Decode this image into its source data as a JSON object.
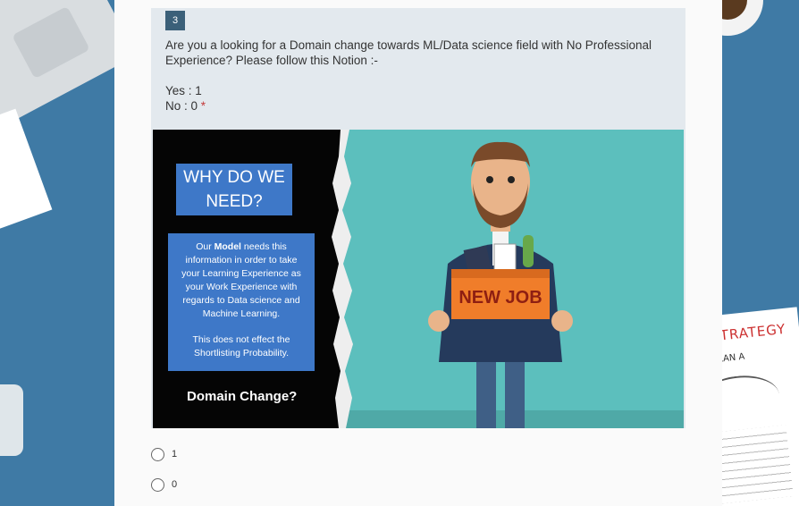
{
  "question": {
    "number": "3",
    "text": "Are you a looking for a Domain change towards ML/Data science field with No Professional Experience? Please follow this Notion :-",
    "yes_line": "Yes : 1",
    "no_line": "No : 0",
    "required_mark": "*"
  },
  "illustration": {
    "heading": "WHY DO WE NEED?",
    "info_pre": "Our ",
    "info_bold": "Model",
    "info_post": " needs this information in order to take your Learning Experience as your Work Experience with regards to Data science and Machine Learning.",
    "info_note": "This does not effect the Shortlisting Probability.",
    "caption": "Domain Change?",
    "box_text": "NEW JOB"
  },
  "options": [
    {
      "label": "1"
    },
    {
      "label": "0"
    }
  ],
  "background": {
    "paper_heading": "SS STRATEGY",
    "paper_sub": "PLAN A"
  },
  "colors": {
    "desk": "#3f7aa5",
    "card": "#e3e9ee",
    "badge": "#3b6079",
    "info_box": "#3e78c8",
    "teal": "#5cbfbd",
    "new_job_box": "#f07d2a"
  }
}
